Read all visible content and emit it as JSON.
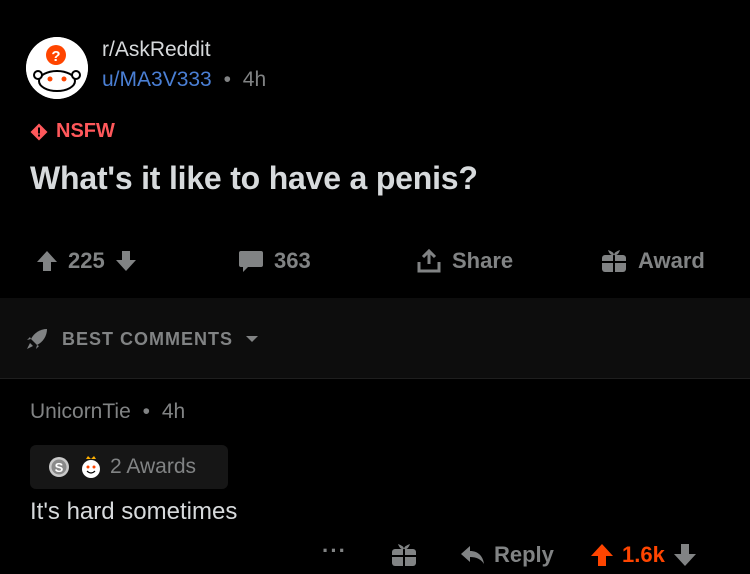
{
  "post": {
    "subreddit": "r/AskReddit",
    "author": "u/MA3V333",
    "separator": "•",
    "age": "4h",
    "nsfw_label": "NSFW",
    "title": "What's it like to have a penis?",
    "votes": "225",
    "comments": "363",
    "share_label": "Share",
    "award_label": "Award"
  },
  "sort": {
    "label": "BEST COMMENTS"
  },
  "comment": {
    "author": "UnicornTie",
    "separator": "•",
    "age": "4h",
    "awards_label": "2 Awards",
    "body": "It's hard sometimes",
    "more_label": "···",
    "reply_label": "Reply",
    "votes": "1.6k"
  },
  "colors": {
    "background": "#000000",
    "text": "#d7dadc",
    "muted": "#818384",
    "username": "#4a7fd4",
    "nsfw": "#ff585b",
    "upvote": "#ff4500"
  },
  "icons": [
    "subreddit-avatar",
    "nsfw-icon",
    "upvote-icon",
    "downvote-icon",
    "comment-icon",
    "share-icon",
    "award-icon",
    "rocket-icon",
    "chevron-down-icon",
    "silver-award-icon",
    "wholesome-award-icon",
    "more-icon",
    "reply-icon"
  ]
}
